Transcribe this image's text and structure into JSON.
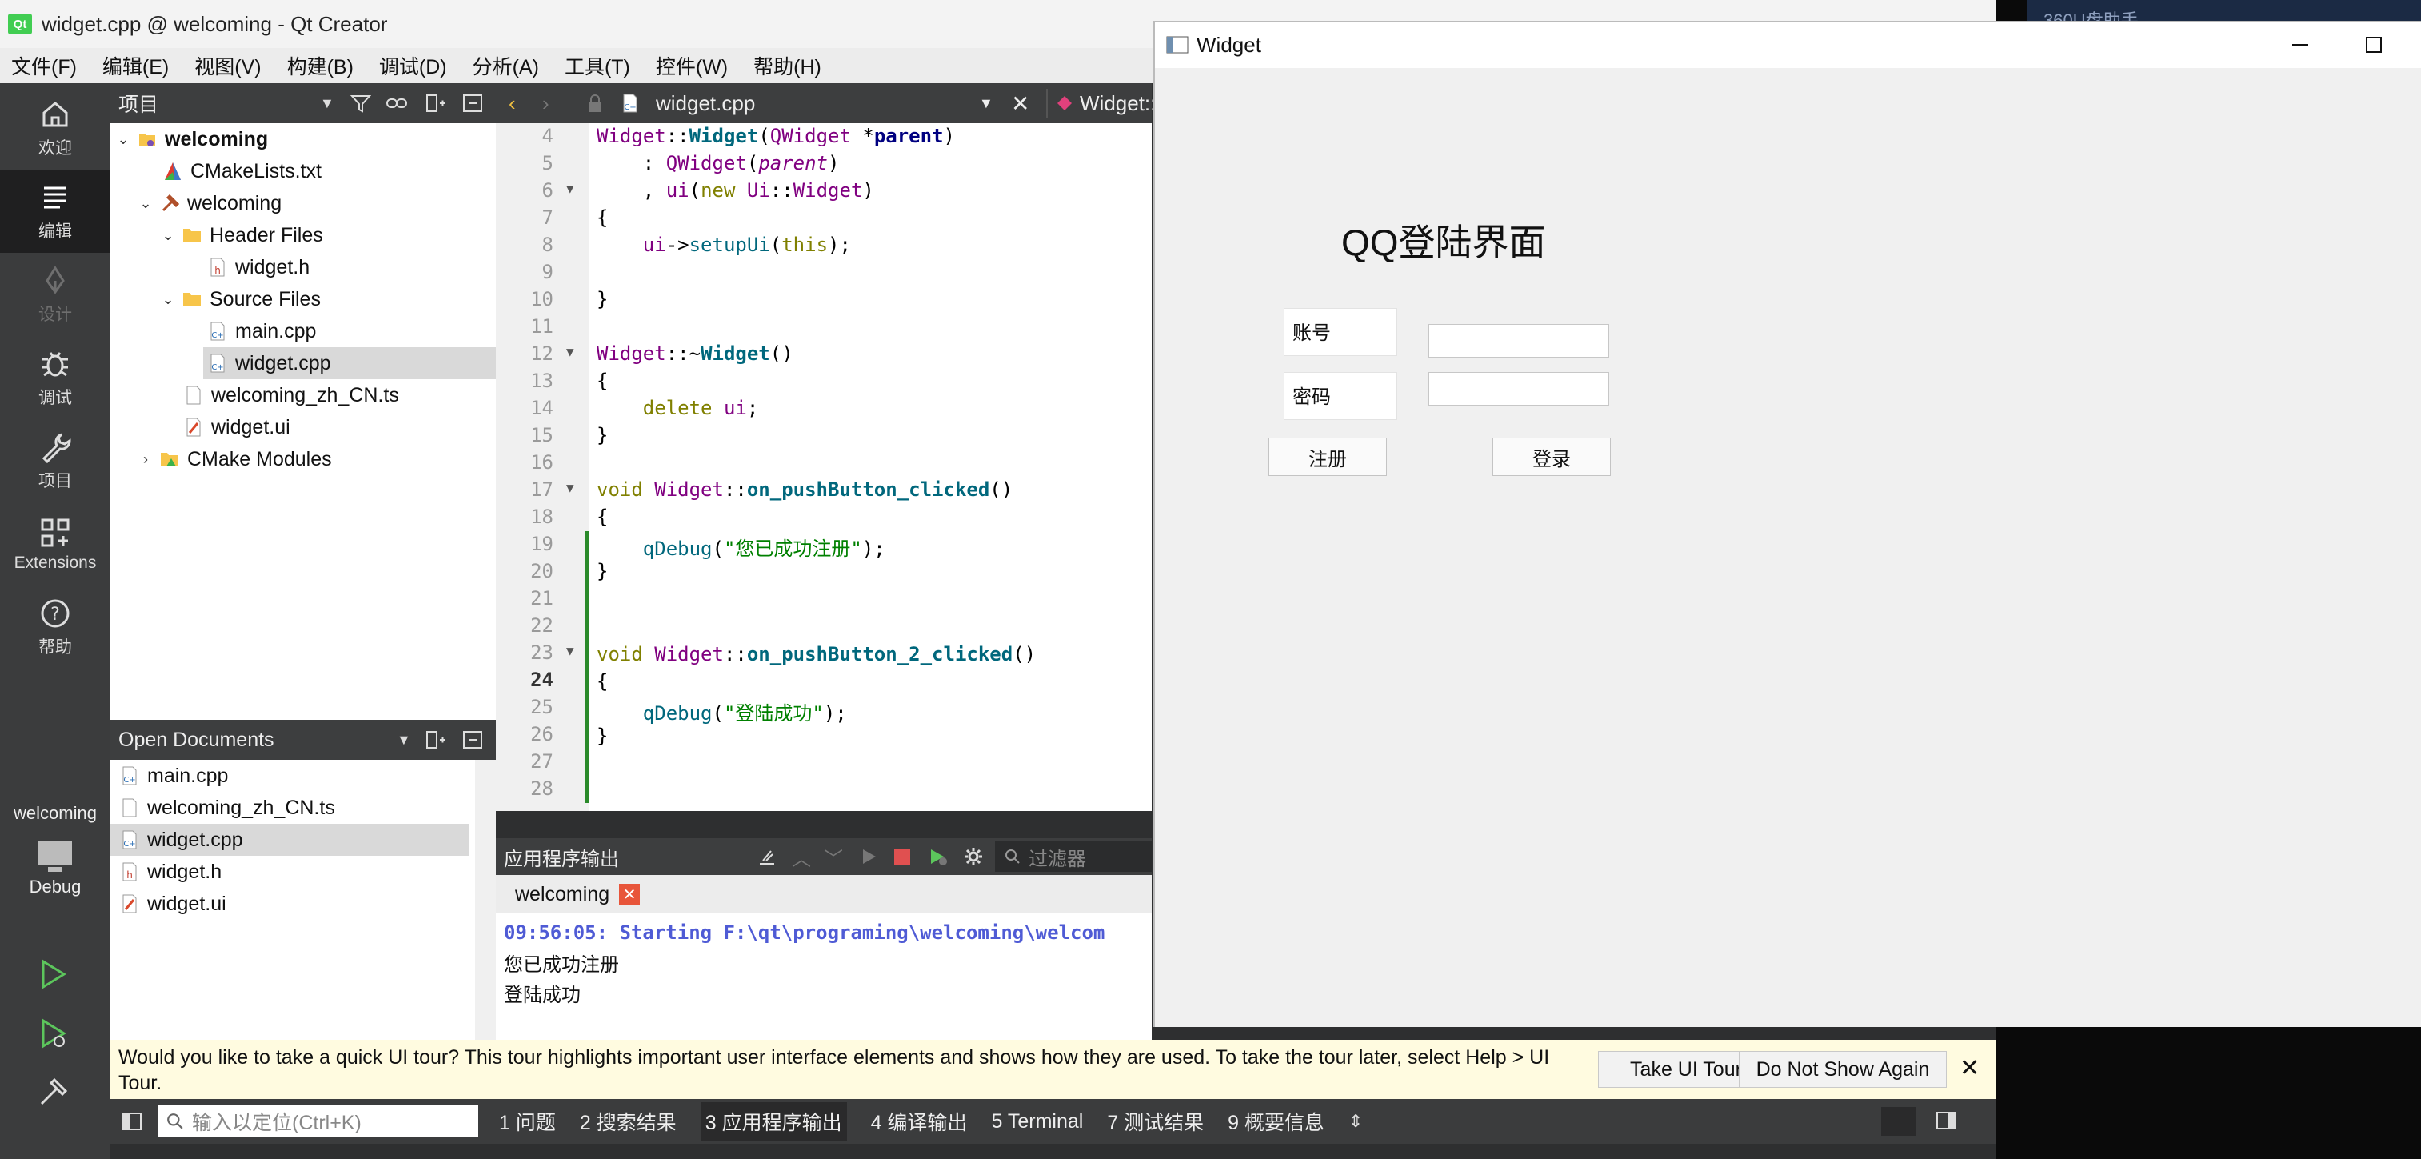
{
  "qt": {
    "title": "widget.cpp @ welcoming - Qt Creator",
    "menu": [
      "文件(F)",
      "编辑(E)",
      "视图(V)",
      "构建(B)",
      "调试(D)",
      "分析(A)",
      "工具(T)",
      "控件(W)",
      "帮助(H)"
    ],
    "modes": [
      {
        "label": "欢迎",
        "icon": "home-icon"
      },
      {
        "label": "编辑",
        "icon": "edit-icon"
      },
      {
        "label": "设计",
        "icon": "design-pen-icon"
      },
      {
        "label": "调试",
        "icon": "bug-icon"
      },
      {
        "label": "项目",
        "icon": "wrench-icon"
      },
      {
        "label": "Extensions",
        "icon": "extensions-icon"
      },
      {
        "label": "帮助",
        "icon": "help-icon"
      }
    ],
    "kit": {
      "project": "welcoming",
      "config": "Debug"
    },
    "project_pane": {
      "title": "项目",
      "tree": [
        {
          "label": "welcoming",
          "bold": true
        },
        {
          "label": "CMakeLists.txt"
        },
        {
          "label": "welcoming"
        },
        {
          "label": "Header Files"
        },
        {
          "label": "widget.h"
        },
        {
          "label": "Source Files"
        },
        {
          "label": "main.cpp"
        },
        {
          "label": "widget.cpp"
        },
        {
          "label": "welcoming_zh_CN.ts"
        },
        {
          "label": "widget.ui"
        },
        {
          "label": "CMake Modules"
        }
      ]
    },
    "open_docs": {
      "title": "Open Documents",
      "items": [
        "main.cpp",
        "welcoming_zh_CN.ts",
        "widget.cpp",
        "widget.h",
        "widget.ui"
      ]
    },
    "editor": {
      "file_tab": "widget.cpp",
      "symbol_tab": "Widget::",
      "line_numbers": [
        "4",
        "5",
        "6",
        "7",
        "8",
        "9",
        "10",
        "11",
        "12",
        "13",
        "14",
        "15",
        "16",
        "17",
        "18",
        "19",
        "20",
        "21",
        "22",
        "23",
        "24",
        "25",
        "26",
        "27",
        "28"
      ]
    },
    "output": {
      "title": "应用程序输出",
      "filter_placeholder": "过滤器",
      "tab": "welcoming",
      "lines": [
        "09:56:05: Starting F:\\qt\\programing\\welcoming\\welcom",
        "您已成功注册",
        "登陆成功"
      ]
    },
    "tour": {
      "message": "Would you like to take a quick UI tour? This tour highlights important user interface elements and shows how they are used. To take the tour later, select Help > UI Tour.",
      "take_label": "Take UI Tour",
      "dismiss_label": "Do Not Show Again"
    },
    "status": {
      "locator_placeholder": "输入以定位(Ctrl+K)",
      "panes": [
        "1  问题",
        "2  搜索结果",
        "3  应用程序输出",
        "4  编译输出",
        "5  Terminal",
        "7  测试结果",
        "9  概要信息"
      ]
    }
  },
  "widget": {
    "title": "Widget",
    "heading": "QQ登陆界面",
    "account_label": "账号",
    "password_label": "密码",
    "register_label": "注册",
    "login_label": "登录"
  },
  "bg_window": {
    "title": "360U盘助手"
  }
}
